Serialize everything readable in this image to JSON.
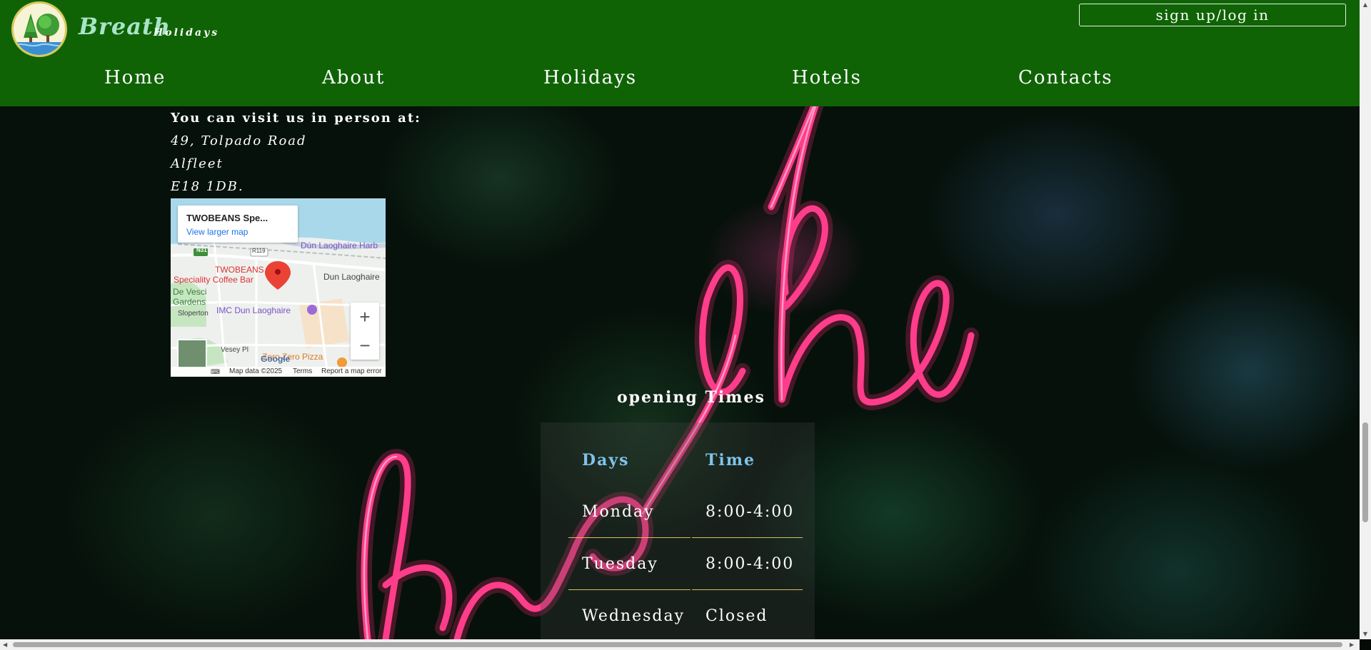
{
  "brand": {
    "name": "Breath",
    "sub": "Holidays"
  },
  "auth": {
    "label": "sign up/log in"
  },
  "nav": [
    {
      "label": "Home"
    },
    {
      "label": "About"
    },
    {
      "label": "Holidays"
    },
    {
      "label": "Hotels"
    },
    {
      "label": "Contacts"
    }
  ],
  "contact": {
    "heading": "You can visit us in person at:",
    "lines": [
      "49, Tolpado Road",
      "Alfleet",
      "E18 1DB."
    ]
  },
  "map": {
    "place_title": "TWOBEANS Spe...",
    "larger_map_link": "View larger map",
    "labels": {
      "harbour": "Dún Laoghaire Harb",
      "marker_name_1": "TWOBEANS",
      "marker_name_2": "Speciality Coffee Bar",
      "town": "Dun Laoghaire",
      "gardens_1": "De Vesci",
      "gardens_2": "Gardens",
      "sloperton": "Sloperton",
      "imc": "IMC Dun Laoghaire",
      "vesey": "Vesey Pl",
      "pizza": "Zero Zero Pizza",
      "road_n31": "N31",
      "road_r119": "R119",
      "google": "Google"
    },
    "zoom_in": "+",
    "zoom_out": "−",
    "footer": {
      "data": "Map data ©2025",
      "terms": "Terms",
      "report": "Report a map error"
    }
  },
  "opening_times": {
    "title": "opening Times",
    "headers": {
      "days": "Days",
      "time": "Time"
    },
    "rows": [
      {
        "day": "Monday",
        "time": "8:00-4:00"
      },
      {
        "day": "Tuesday",
        "time": "8:00-4:00"
      },
      {
        "day": "Wednesday",
        "time": "Closed"
      }
    ]
  },
  "colors": {
    "header_bg": "#0f6305",
    "neon_pink": "#ff3d8b",
    "table_header": "#7fc3ea",
    "table_rule": "#d6bf57"
  },
  "icons": {
    "logo": "tree-logo-icon",
    "map_marker": "map-pin-icon",
    "keyboard": "keyboard-icon"
  }
}
